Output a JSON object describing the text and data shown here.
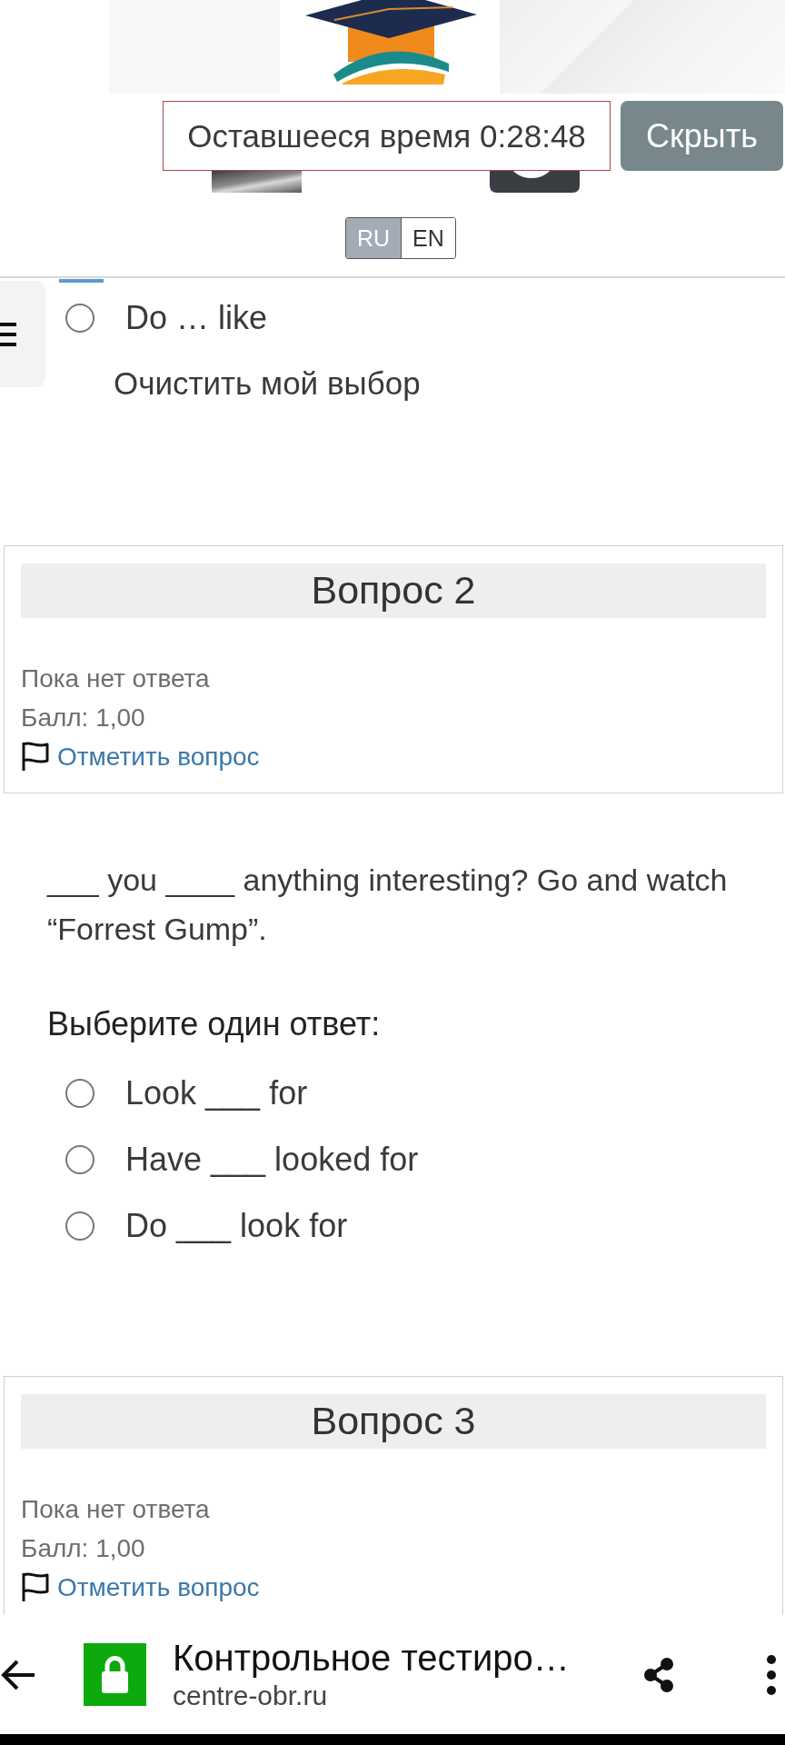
{
  "header": {
    "timer": "Оставшееся время 0:28:48",
    "hide_button": "Скрыть",
    "languages": [
      {
        "label": "RU",
        "selected": true
      },
      {
        "label": "EN",
        "selected": false
      }
    ]
  },
  "previous_question": {
    "options": [
      {
        "label": "Do … like",
        "selected": false
      }
    ],
    "clear_choice": "Очистить мой выбор"
  },
  "questions": [
    {
      "title": "Вопрос 2",
      "status": "Пока нет ответа",
      "mark": "Балл: 1,00",
      "flag_link": "Отметить вопрос",
      "text": "___ you ____ anything interesting? Go and watch “Forrest Gump”.",
      "prompt": "Выберите один ответ:",
      "options": [
        {
          "label": "Look ___ for",
          "selected": false
        },
        {
          "label": "Have ___ looked for",
          "selected": false
        },
        {
          "label": "Do ___ look for",
          "selected": false
        }
      ]
    },
    {
      "title": "Вопрос 3",
      "status": "Пока нет ответа",
      "mark": "Балл: 1,00",
      "flag_link": "Отметить вопрос"
    }
  ],
  "browser_bar": {
    "title": "Контрольное тестиро…",
    "url": "centre-obr.ru"
  }
}
